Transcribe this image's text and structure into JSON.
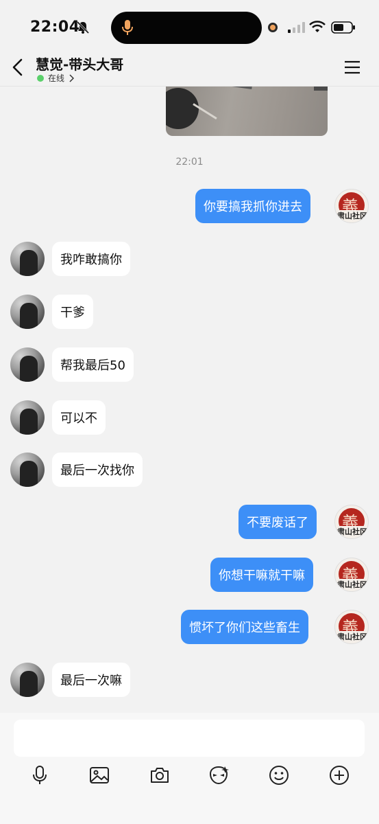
{
  "status_bar": {
    "time": "22:04"
  },
  "header": {
    "title": "慧觉-带头大哥",
    "presence": "在线"
  },
  "chat": {
    "timestamp": "22:01",
    "self_avatar_text": {
      "seal": "義",
      "caption": "肃山社区"
    },
    "messages": [
      {
        "side": "out",
        "text": "你要搞我抓你进去"
      },
      {
        "side": "in",
        "text": "我咋敢搞你"
      },
      {
        "side": "in",
        "text": "干爹"
      },
      {
        "side": "in",
        "text": "帮我最后50"
      },
      {
        "side": "in",
        "text": "可以不"
      },
      {
        "side": "in",
        "text": "最后一次找你"
      },
      {
        "side": "out",
        "text": "不要废话了"
      },
      {
        "side": "out",
        "text": "你想干嘛就干嘛"
      },
      {
        "side": "out",
        "text": "惯坏了你们这些畜生"
      },
      {
        "side": "in",
        "text": "最后一次嘛"
      }
    ]
  },
  "input": {
    "value": ""
  },
  "toolbar": {
    "items": [
      "mic-icon",
      "image-icon",
      "camera-icon",
      "sticker-icon",
      "emoji-icon",
      "plus-icon"
    ]
  },
  "colors": {
    "outgoing_bubble": "#3d8ff7",
    "incoming_bubble": "#ffffff",
    "background": "#f2f2f2",
    "online": "#5bd06b"
  }
}
